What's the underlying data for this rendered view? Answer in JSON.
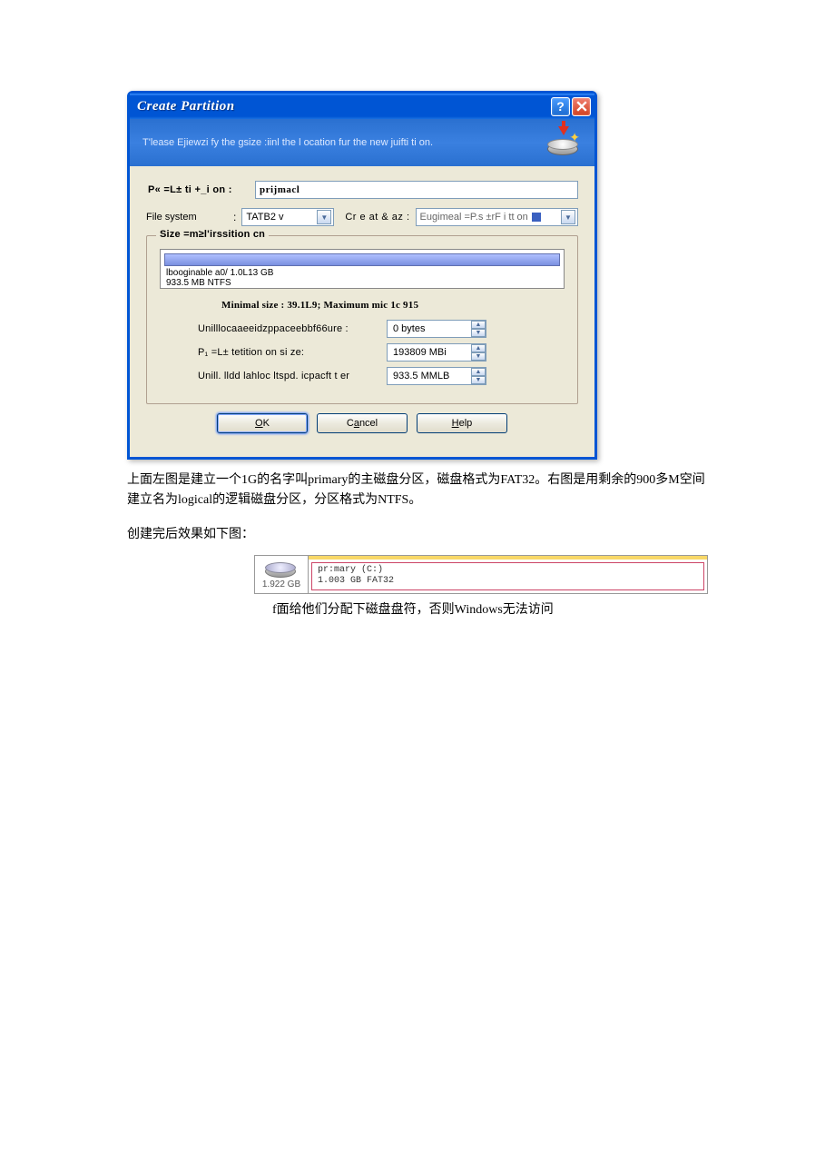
{
  "dialog": {
    "title": "Create Partition",
    "banner_text": "T'lease Ejiewzi fy the   gsize :iinl the l ocation fur the new juifti ti on.",
    "partition_label": "P« =L± ti +_i on :",
    "partition_value": "prijmacl",
    "fs_label": "File system",
    "fs_value": "TATB2 v",
    "create_as_label": "Cr e at & az :",
    "create_as_value": "Eugimeal =P.s ±rF i tt on",
    "fieldset_legend": "Size =m≥l'irssition cn",
    "bar_line1": "lbooginable a0/ 1.0L13 GB",
    "bar_line2": "933.5 MB   NTFS",
    "minmax": "Minimal size : 39.1L9; Maximum mic 1c 915",
    "row1_label": "Unilllocaaeeidzppaceebbf66ure    :",
    "row1_value": "0 bytes",
    "row2_label": "P₁ =L± tetition on si ze:",
    "row2_value": "193809 MBi",
    "row3_label": "Unill. lldd lahloc ltspd. icpacft t er",
    "row3_value": "933.5 MMLB",
    "btn_ok": "OK",
    "btn_cancel": "Cancel",
    "btn_help": "Help"
  },
  "caption1": "上面左图是建立一个1G的名字叫primary的主磁盘分区，磁盘格式为FAT32。右图是用剩余的900多M空间建立名为logical的逻辑磁盘分区，分区格式为NTFS。",
  "caption2": "创建完后效果如下图：",
  "result": {
    "disk_size": "1.922 GB",
    "part_name": "pr:mary (C:)",
    "part_info": "1.003 GB  FAT32"
  },
  "caption3": "f面给他们分配下磁盘盘符，否则Windows无法访问"
}
